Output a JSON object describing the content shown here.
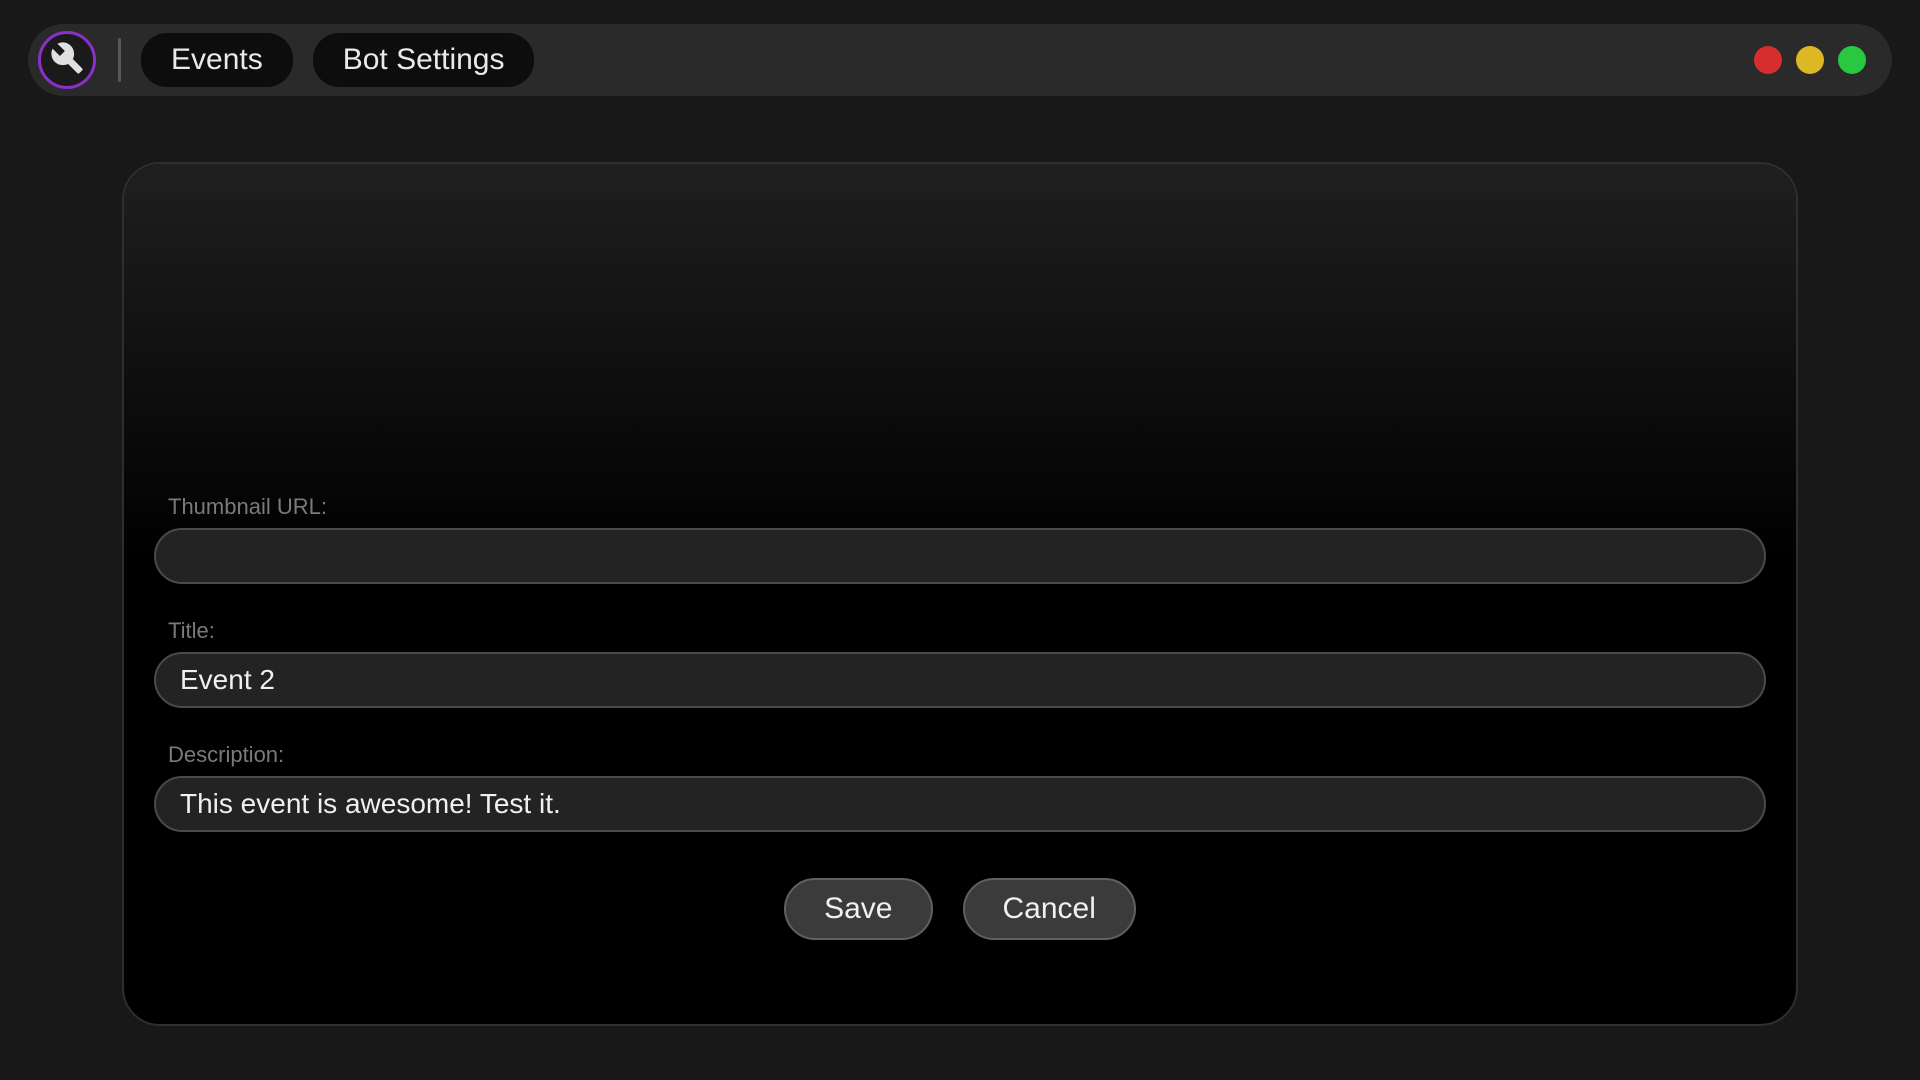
{
  "titlebar": {
    "tabs": [
      {
        "label": "Events"
      },
      {
        "label": "Bot Settings"
      }
    ],
    "window_controls": {
      "close_color": "#d62e2e",
      "minimize_color": "#dcb825",
      "maximize_color": "#28c840"
    },
    "icon_name": "wrench-icon",
    "accent_color": "#8b2fc9"
  },
  "form": {
    "thumbnail_url": {
      "label": "Thumbnail URL:",
      "value": "",
      "placeholder": ""
    },
    "title": {
      "label": "Title:",
      "value": "Event 2",
      "placeholder": ""
    },
    "description": {
      "label": "Description:",
      "value": "This event is awesome! Test it.",
      "placeholder": ""
    }
  },
  "actions": {
    "save_label": "Save",
    "cancel_label": "Cancel"
  }
}
